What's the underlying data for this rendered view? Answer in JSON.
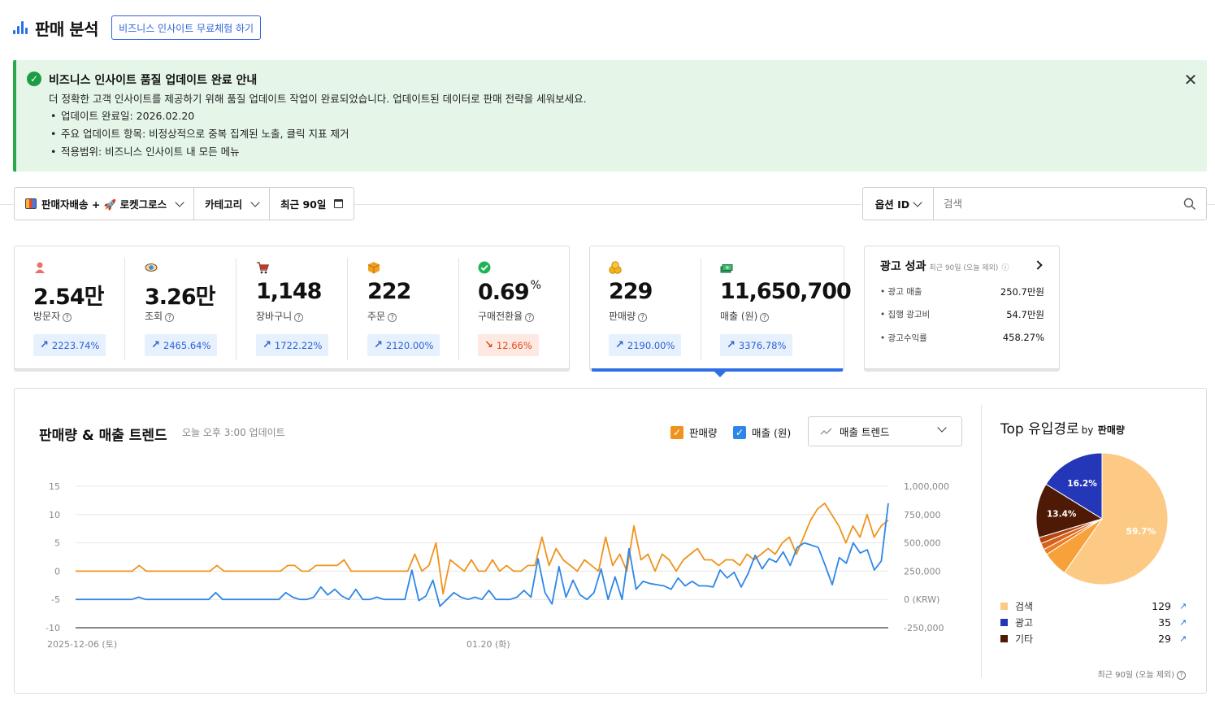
{
  "header": {
    "title": "판매 분석",
    "trial_button": "비즈니스 인사이트 무료체험 하기"
  },
  "notice": {
    "title": "비즈니스 인사이트 품질 업데이트 완료 안내",
    "description": "더 정확한 고객 인사이트를 제공하기 위해 품질 업데이트 작업이 완료되었습니다. 업데이트된 데이터로 판매 전략을 세워보세요.",
    "items": [
      "업데이트 완료일: 2026.02.20",
      "주요 업데이트 항목: 비정상적으로 중복 집계된 노출, 클릭 지표 제거",
      "적용범위: 비즈니스 인사이트 내 모든 메뉴"
    ]
  },
  "filters": {
    "delivery": "판매자배송 + 🚀 로켓그로스",
    "category": "카테고리",
    "period": "최근 90일"
  },
  "search": {
    "option": "옵션 ID",
    "placeholder": "검색"
  },
  "kpis": [
    {
      "label": "방문자",
      "value": "2.54만",
      "change": "2223.74%",
      "direction": "up",
      "icon": "person-icon",
      "color": "#e8736d"
    },
    {
      "label": "조회",
      "value": "3.26만",
      "change": "2465.64%",
      "direction": "up",
      "icon": "eye-icon",
      "color": "#3a8fd8"
    },
    {
      "label": "장바구니",
      "value": "1,148",
      "change": "1722.22%",
      "direction": "up",
      "icon": "cart-icon",
      "color": "#8a4b3a"
    },
    {
      "label": "주문",
      "value": "222",
      "change": "2120.00%",
      "direction": "up",
      "icon": "box-icon",
      "color": "#f0a020"
    },
    {
      "label": "구매전환율",
      "value": "0.69",
      "unit": "%",
      "change": "12.66%",
      "direction": "down",
      "icon": "check-icon",
      "color": "#1fb35a"
    }
  ],
  "sales": [
    {
      "label": "판매량",
      "value": "229",
      "change": "2190.00%",
      "direction": "up",
      "icon": "coins-icon",
      "color": "#f5b41c"
    },
    {
      "label": "매출 (원)",
      "value": "11,650,700",
      "change": "3376.78%",
      "direction": "up",
      "icon": "money-icon",
      "color": "#2e9e5b"
    }
  ],
  "ad": {
    "title": "광고 성과",
    "subtitle": "최근 90일 (오늘 제외)",
    "rows": [
      {
        "name": "광고 매출",
        "value": "250.7만원"
      },
      {
        "name": "집행 광고비",
        "value": "54.7만원"
      },
      {
        "name": "광고수익률",
        "value": "458.27%"
      }
    ]
  },
  "trend": {
    "title": "판매량 & 매출 트렌드",
    "updated": "오늘 오후 3:00 업데이트",
    "legend_qty": "판매량",
    "legend_rev": "매출 (원)",
    "mode": "매출 트렌드",
    "colors": {
      "qty": "#f0931c",
      "rev": "#2e86e8"
    }
  },
  "chart_data": {
    "type": "line",
    "x_labels": [
      "2025-12-06 (토)",
      "01.20 (화)"
    ],
    "y_left_ticks": [
      "15",
      "10",
      "5",
      "0",
      "-5",
      "-10"
    ],
    "y_right_ticks": [
      "1,000,000",
      "750,000",
      "500,000",
      "250,000",
      "0 (KRW)",
      "-250,000"
    ],
    "y_left_range": [
      -10,
      15
    ],
    "y_right_range": [
      -250000,
      1000000
    ],
    "series": [
      {
        "name": "판매량",
        "axis": "left",
        "values": [
          0,
          0,
          0,
          0,
          0,
          0,
          0,
          0,
          0,
          1,
          0,
          0,
          0,
          0,
          0,
          0,
          0,
          0,
          0,
          0,
          1,
          0,
          0,
          0,
          0,
          0,
          0,
          0,
          0,
          0,
          1,
          1,
          0,
          0,
          1,
          1,
          1,
          1,
          2,
          0,
          0,
          0,
          0,
          0,
          0,
          0,
          0,
          0,
          3,
          0,
          1,
          5,
          -4,
          2,
          1,
          0,
          2,
          0,
          0,
          2,
          0,
          1,
          0,
          0,
          1,
          1,
          6,
          1,
          4,
          2,
          1,
          0,
          2,
          1,
          0,
          6,
          1,
          3,
          0,
          8,
          2,
          3,
          0,
          3,
          2,
          0,
          2,
          3,
          4,
          2,
          2,
          1,
          2,
          2,
          1,
          3,
          2,
          3,
          4,
          3,
          5,
          6,
          3,
          6,
          9,
          11,
          12,
          10,
          8,
          5,
          8,
          6,
          10,
          6,
          8,
          9
        ]
      },
      {
        "name": "매출 (원)",
        "axis": "right",
        "values": [
          0,
          0,
          0,
          0,
          0,
          0,
          0,
          0,
          0,
          20000,
          0,
          0,
          0,
          0,
          0,
          0,
          0,
          0,
          0,
          0,
          60000,
          0,
          0,
          0,
          0,
          0,
          0,
          0,
          0,
          0,
          60000,
          20000,
          0,
          0,
          20000,
          110000,
          40000,
          90000,
          30000,
          0,
          90000,
          0,
          0,
          20000,
          0,
          0,
          0,
          0,
          260000,
          -10000,
          30000,
          170000,
          -60000,
          0,
          60000,
          20000,
          0,
          20000,
          0,
          80000,
          0,
          0,
          0,
          20000,
          80000,
          20000,
          360000,
          60000,
          -40000,
          290000,
          20000,
          170000,
          40000,
          0,
          60000,
          270000,
          0,
          200000,
          0,
          450000,
          90000,
          160000,
          140000,
          130000,
          120000,
          90000,
          190000,
          120000,
          160000,
          120000,
          120000,
          110000,
          260000,
          190000,
          240000,
          110000,
          230000,
          390000,
          270000,
          360000,
          330000,
          420000,
          300000,
          460000,
          500000,
          480000,
          460000,
          300000,
          130000,
          370000,
          320000,
          500000,
          410000,
          440000,
          260000,
          340000,
          850000
        ]
      }
    ]
  },
  "pie": {
    "title": "Top 유입경로",
    "by": "by",
    "metric": "판매량",
    "footer": "최근 90일 (오늘 제외)",
    "slices": [
      {
        "name": "검색",
        "pct": 59.7,
        "label": "59.7%",
        "color": "#fdca86"
      },
      {
        "name": "slice-5",
        "pct": 6.2,
        "label": "",
        "color": "#f6a13a"
      },
      {
        "name": "slice-4",
        "pct": 1.4,
        "label": "",
        "color": "#ea7d26"
      },
      {
        "name": "slice-3",
        "pct": 1.6,
        "label": "",
        "color": "#d9621b"
      },
      {
        "name": "slice-2",
        "pct": 1.5,
        "label": "",
        "color": "#b44712"
      },
      {
        "name": "기타",
        "pct": 13.4,
        "label": "13.4%",
        "color": "#4e1a06"
      },
      {
        "name": "광고",
        "pct": 16.2,
        "label": "16.2%",
        "color": "#2437b8"
      }
    ],
    "legend": [
      {
        "name": "검색",
        "count": "129",
        "color": "#fdca86"
      },
      {
        "name": "광고",
        "count": "35",
        "color": "#2437b8"
      },
      {
        "name": "기타",
        "count": "29",
        "color": "#4e1a06"
      }
    ]
  }
}
